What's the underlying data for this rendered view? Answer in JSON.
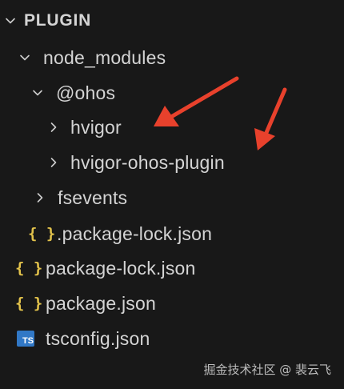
{
  "explorer": {
    "section_title": "PLUGIN",
    "items": [
      {
        "label": "node_modules",
        "kind": "folder",
        "expanded": true
      },
      {
        "label": "@ohos",
        "kind": "folder",
        "expanded": true
      },
      {
        "label": "hvigor",
        "kind": "folder",
        "expanded": false
      },
      {
        "label": "hvigor-ohos-plugin",
        "kind": "folder",
        "expanded": false
      },
      {
        "label": "fsevents",
        "kind": "folder",
        "expanded": false
      },
      {
        "label": ".package-lock.json",
        "kind": "json",
        "icon": "{ }"
      },
      {
        "label": "package-lock.json",
        "kind": "json",
        "icon": "{ }"
      },
      {
        "label": "package.json",
        "kind": "json",
        "icon": "{ }"
      },
      {
        "label": "tsconfig.json",
        "kind": "ts",
        "icon": "TS"
      }
    ]
  },
  "watermark": "掘金技术社区 @ 裴云飞",
  "colors": {
    "background": "#181818",
    "text": "#d4d4d4",
    "json_icon": "#e2c24b",
    "ts_icon": "#3178c6",
    "annotation_arrow": "#e8412c"
  }
}
